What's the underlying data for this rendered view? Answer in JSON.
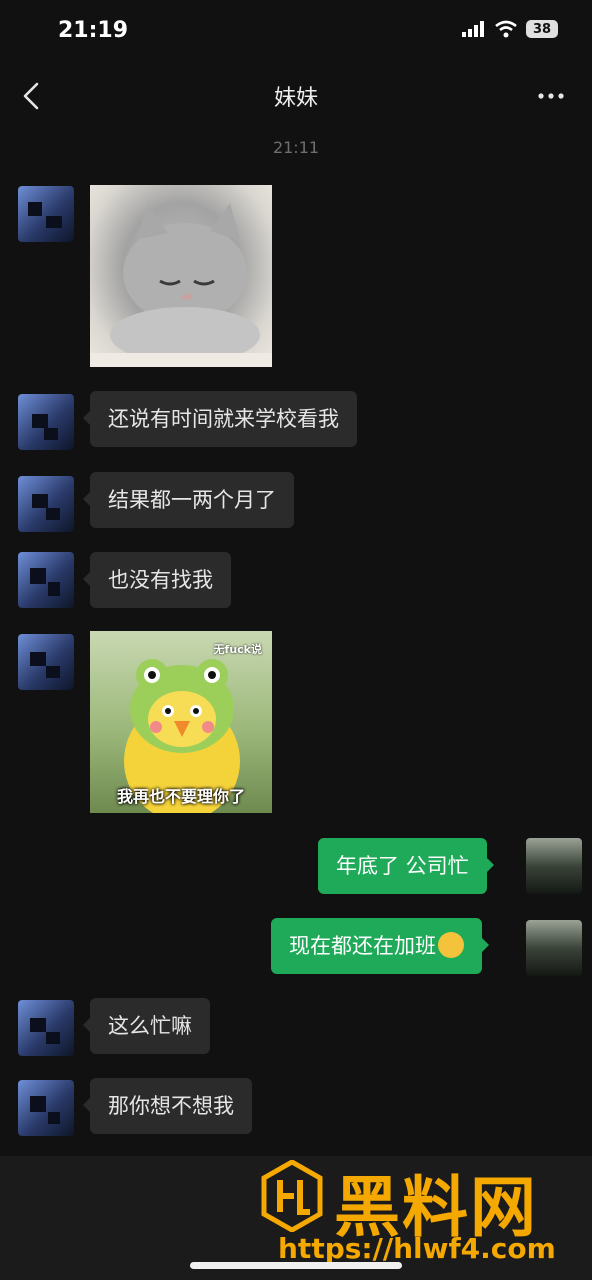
{
  "status_bar": {
    "time": "21:19",
    "battery": "38"
  },
  "header": {
    "title": "妹妹"
  },
  "timestamp": "21:11",
  "messages": [
    {
      "side": "in",
      "type": "sticker",
      "sticker": "sleepy-cat"
    },
    {
      "side": "in",
      "type": "text",
      "text": "还说有时间就来学校看我"
    },
    {
      "side": "in",
      "type": "text",
      "text": "结果都一两个月了"
    },
    {
      "side": "in",
      "type": "text",
      "text": "也没有找我"
    },
    {
      "side": "in",
      "type": "sticker",
      "sticker": "duck-in-frog-hat",
      "caption": "我再也不要理你了",
      "tag": "无fuck说"
    },
    {
      "side": "out",
      "type": "text",
      "text": "年底了 公司忙"
    },
    {
      "side": "out",
      "type": "text",
      "text": "现在都还在加班",
      "emoji": "zany-face"
    },
    {
      "side": "in",
      "type": "text",
      "text": "这么忙嘛"
    },
    {
      "side": "in",
      "type": "text",
      "text": "那你想不想我"
    }
  ],
  "watermark": {
    "title": "黑料网",
    "url": "https://hlwf4.com",
    "color": "#f5a900"
  },
  "colors": {
    "background": "#111111",
    "incoming_bubble": "#2b2b2b",
    "outgoing_bubble": "#1faa59"
  }
}
